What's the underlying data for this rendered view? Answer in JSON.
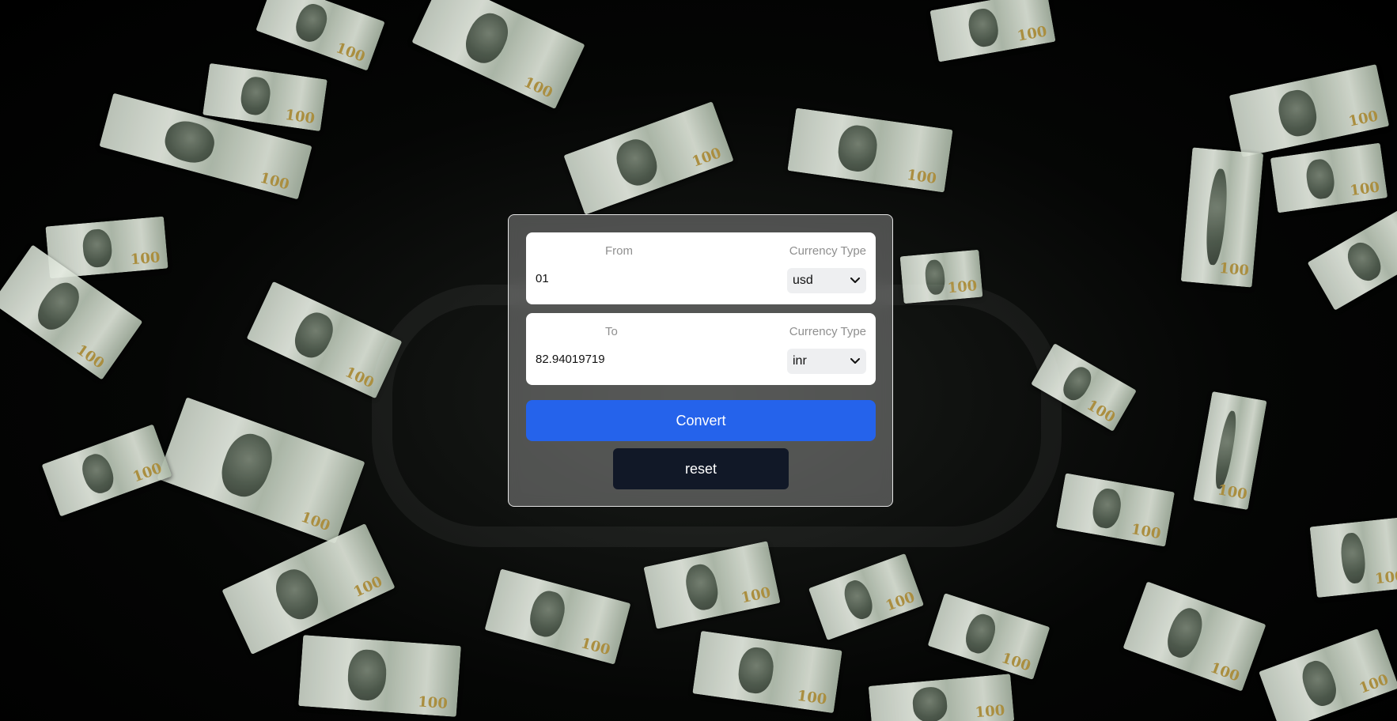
{
  "background": {
    "description_icon": "falling-dollar-bills-icon"
  },
  "from_card": {
    "label": "From",
    "currency_type_label": "Currency Type",
    "amount_value": "01",
    "currency_selected": "usd"
  },
  "to_card": {
    "label": "To",
    "currency_type_label": "Currency Type",
    "amount_value": "82.94019719",
    "currency_selected": "inr"
  },
  "buttons": {
    "convert_label": "Convert",
    "reset_label": "reset"
  },
  "colors": {
    "convert_button": "#2563eb",
    "reset_button": "#111827",
    "label_gray": "#8f8f8f"
  }
}
